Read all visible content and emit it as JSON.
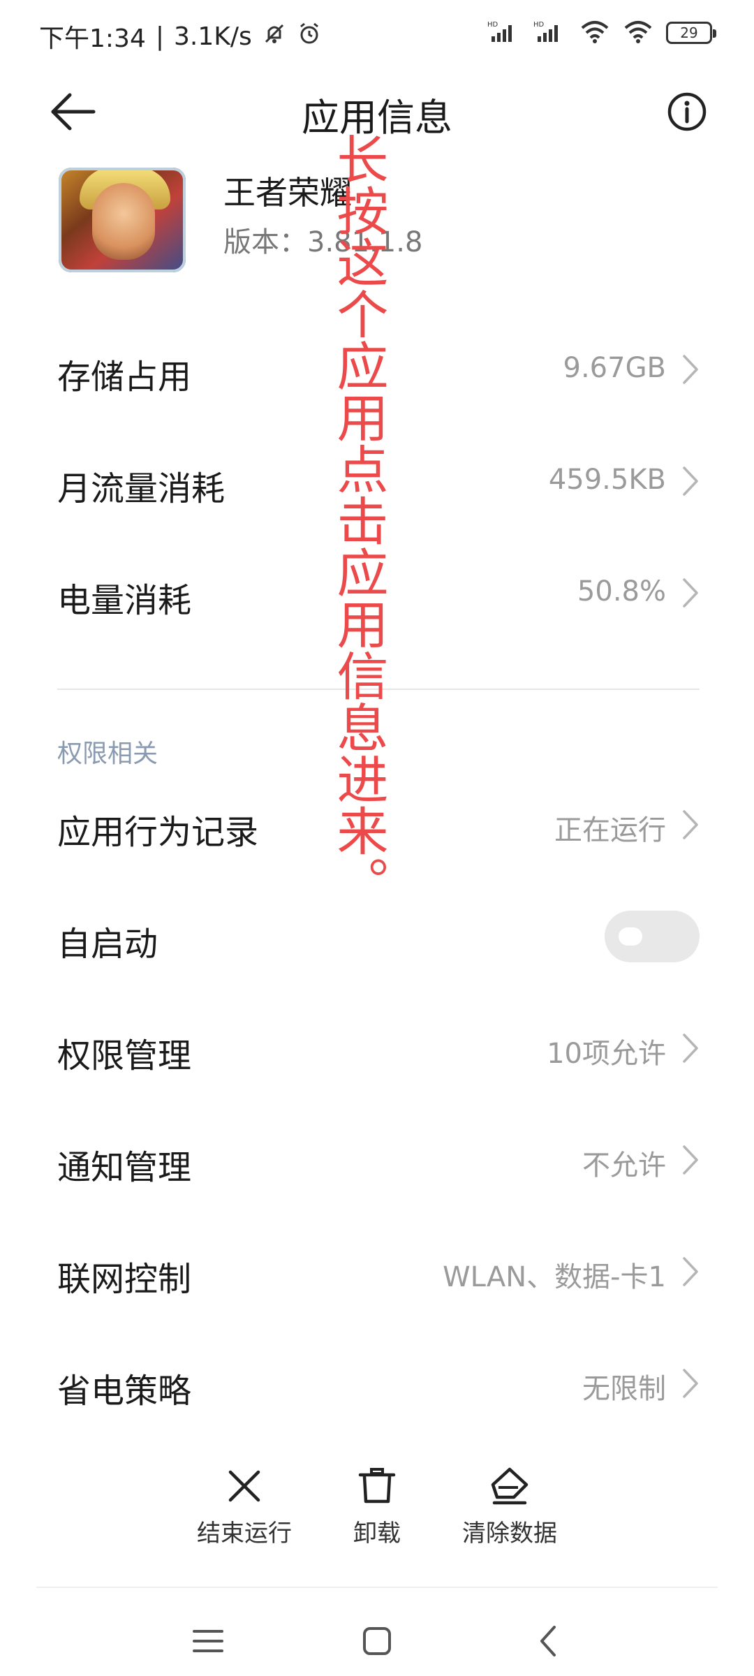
{
  "status_bar": {
    "time": "下午1:34",
    "separator": "|",
    "network_speed": "3.1K/s",
    "battery": "29",
    "icons": [
      "mute-icon",
      "alarm-icon",
      "hd-signal-icon",
      "hd-signal-icon",
      "wifi-icon",
      "wifi-icon",
      "battery-icon"
    ]
  },
  "header": {
    "title": "应用信息",
    "back_icon": "back-arrow-icon",
    "info_icon": "info-icon"
  },
  "app": {
    "name": "王者荣耀",
    "version": "版本：3.81.1.8"
  },
  "overlay_annotation": "长按这个应用点击应用信息进来。",
  "rows_main": [
    {
      "label": "存储占用",
      "value": "9.67GB"
    },
    {
      "label": "月流量消耗",
      "value": "459.5KB"
    },
    {
      "label": "电量消耗",
      "value": "50.8%"
    }
  ],
  "section": {
    "title": "权限相关"
  },
  "rows_permissions": [
    {
      "label": "应用行为记录",
      "value": "正在运行"
    },
    {
      "label": "自启动",
      "value": "",
      "toggle": false
    },
    {
      "label": "权限管理",
      "value": "10项允许"
    },
    {
      "label": "通知管理",
      "value": "不允许"
    },
    {
      "label": "联网控制",
      "value": "WLAN、数据-卡1"
    },
    {
      "label": "省电策略",
      "value": "无限制"
    }
  ],
  "actions": [
    {
      "label": "结束运行",
      "icon": "close-icon"
    },
    {
      "label": "卸载",
      "icon": "trash-icon"
    },
    {
      "label": "清除数据",
      "icon": "eraser-icon"
    }
  ],
  "nav": {
    "icons": [
      "menu-icon",
      "home-icon",
      "back-icon"
    ]
  },
  "colors": {
    "overlay_text": "#ec4a4a",
    "value_text": "#9a9a9a",
    "section_title": "#8a9ab0",
    "toggle_off": "#e8e8e8"
  }
}
